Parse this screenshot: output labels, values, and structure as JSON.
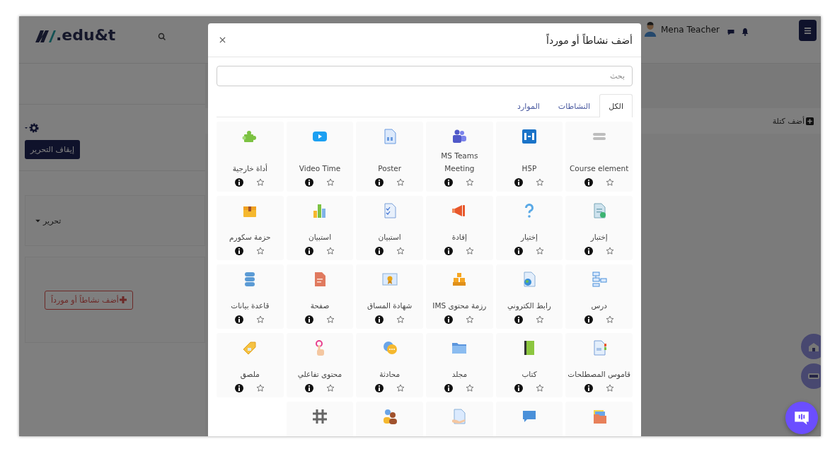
{
  "header": {
    "logo_text": ".edu&t",
    "user_name": "Mena Teacher"
  },
  "sidebar": {
    "stop_editing_button": "إيقاف التحرير",
    "edit_menu": "تحرير",
    "add_activity_button": "أضف نشاطاً أو مورداً"
  },
  "main": {
    "add_block": "أضف كتلة"
  },
  "dialog": {
    "title": "أضف نشاطاً أو مورداً",
    "search": {
      "placeholder": "بحث"
    },
    "tabs": [
      {
        "label": "الكل",
        "selected": true
      },
      {
        "label": "النشاطات",
        "selected": false
      },
      {
        "label": "الموارد",
        "selected": false
      }
    ],
    "items": [
      {
        "kind": "full",
        "label": "Course element",
        "starred": false
      },
      {
        "kind": "full",
        "label": "H5P",
        "starred": false
      },
      {
        "kind": "full",
        "label": "MS Teams Meeting",
        "starred": false
      },
      {
        "kind": "full",
        "label": "Poster",
        "starred": false
      },
      {
        "kind": "full",
        "label": "Video Time",
        "starred": false
      },
      {
        "kind": "full",
        "label": "أداة خارجية",
        "starred": false
      },
      {
        "kind": "full",
        "label": "إختبار",
        "starred": false
      },
      {
        "kind": "full",
        "label": "إختيار",
        "starred": false
      },
      {
        "kind": "full",
        "label": "إفادة",
        "starred": false
      },
      {
        "kind": "full",
        "label": "استبيان",
        "starred": false
      },
      {
        "kind": "full",
        "label": "استبيان",
        "starred": false
      },
      {
        "kind": "full",
        "label": "حزمة سكورم",
        "starred": false
      },
      {
        "kind": "full",
        "label": "درس",
        "starred": false
      },
      {
        "kind": "full",
        "label": "رابط الكتروني",
        "starred": false
      },
      {
        "kind": "full",
        "label": "رزمة محتوى IMS",
        "starred": false
      },
      {
        "kind": "full",
        "label": "شهادة المساق",
        "starred": false
      },
      {
        "kind": "full",
        "label": "صفحة",
        "starred": false
      },
      {
        "kind": "full",
        "label": "قاعدة بيانات",
        "starred": false
      },
      {
        "kind": "full",
        "label": "قاموس المصطلحات",
        "starred": false
      },
      {
        "kind": "full",
        "label": "كتاب",
        "starred": false
      },
      {
        "kind": "full",
        "label": "مجلد",
        "starred": false
      },
      {
        "kind": "full",
        "label": "محادثة",
        "starred": false
      },
      {
        "kind": "full",
        "label": "محتوى تفاعلي",
        "starred": false
      },
      {
        "kind": "full",
        "label": "ملصق",
        "starred": false
      },
      {
        "kind": "cut"
      },
      {
        "kind": "cut"
      },
      {
        "kind": "cut"
      },
      {
        "kind": "cut"
      },
      {
        "kind": "cut"
      }
    ]
  }
}
